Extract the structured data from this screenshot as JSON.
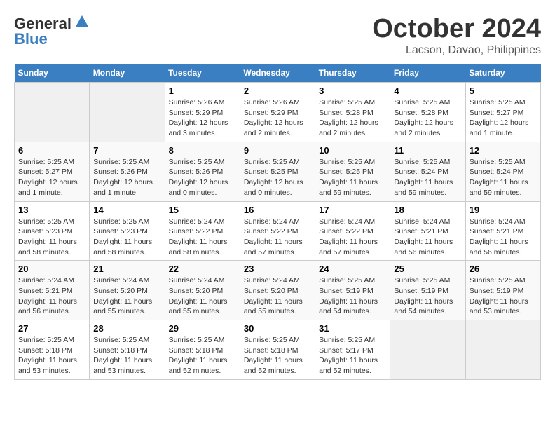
{
  "header": {
    "logo_general": "General",
    "logo_blue": "Blue",
    "month_title": "October 2024",
    "location": "Lacson, Davao, Philippines"
  },
  "calendar": {
    "days_of_week": [
      "Sunday",
      "Monday",
      "Tuesday",
      "Wednesday",
      "Thursday",
      "Friday",
      "Saturday"
    ],
    "weeks": [
      [
        {
          "day": "",
          "info": ""
        },
        {
          "day": "",
          "info": ""
        },
        {
          "day": "1",
          "info": "Sunrise: 5:26 AM\nSunset: 5:29 PM\nDaylight: 12 hours and 3 minutes."
        },
        {
          "day": "2",
          "info": "Sunrise: 5:26 AM\nSunset: 5:29 PM\nDaylight: 12 hours and 2 minutes."
        },
        {
          "day": "3",
          "info": "Sunrise: 5:25 AM\nSunset: 5:28 PM\nDaylight: 12 hours and 2 minutes."
        },
        {
          "day": "4",
          "info": "Sunrise: 5:25 AM\nSunset: 5:28 PM\nDaylight: 12 hours and 2 minutes."
        },
        {
          "day": "5",
          "info": "Sunrise: 5:25 AM\nSunset: 5:27 PM\nDaylight: 12 hours and 1 minute."
        }
      ],
      [
        {
          "day": "6",
          "info": "Sunrise: 5:25 AM\nSunset: 5:27 PM\nDaylight: 12 hours and 1 minute."
        },
        {
          "day": "7",
          "info": "Sunrise: 5:25 AM\nSunset: 5:26 PM\nDaylight: 12 hours and 1 minute."
        },
        {
          "day": "8",
          "info": "Sunrise: 5:25 AM\nSunset: 5:26 PM\nDaylight: 12 hours and 0 minutes."
        },
        {
          "day": "9",
          "info": "Sunrise: 5:25 AM\nSunset: 5:25 PM\nDaylight: 12 hours and 0 minutes."
        },
        {
          "day": "10",
          "info": "Sunrise: 5:25 AM\nSunset: 5:25 PM\nDaylight: 11 hours and 59 minutes."
        },
        {
          "day": "11",
          "info": "Sunrise: 5:25 AM\nSunset: 5:24 PM\nDaylight: 11 hours and 59 minutes."
        },
        {
          "day": "12",
          "info": "Sunrise: 5:25 AM\nSunset: 5:24 PM\nDaylight: 11 hours and 59 minutes."
        }
      ],
      [
        {
          "day": "13",
          "info": "Sunrise: 5:25 AM\nSunset: 5:23 PM\nDaylight: 11 hours and 58 minutes."
        },
        {
          "day": "14",
          "info": "Sunrise: 5:25 AM\nSunset: 5:23 PM\nDaylight: 11 hours and 58 minutes."
        },
        {
          "day": "15",
          "info": "Sunrise: 5:24 AM\nSunset: 5:22 PM\nDaylight: 11 hours and 58 minutes."
        },
        {
          "day": "16",
          "info": "Sunrise: 5:24 AM\nSunset: 5:22 PM\nDaylight: 11 hours and 57 minutes."
        },
        {
          "day": "17",
          "info": "Sunrise: 5:24 AM\nSunset: 5:22 PM\nDaylight: 11 hours and 57 minutes."
        },
        {
          "day": "18",
          "info": "Sunrise: 5:24 AM\nSunset: 5:21 PM\nDaylight: 11 hours and 56 minutes."
        },
        {
          "day": "19",
          "info": "Sunrise: 5:24 AM\nSunset: 5:21 PM\nDaylight: 11 hours and 56 minutes."
        }
      ],
      [
        {
          "day": "20",
          "info": "Sunrise: 5:24 AM\nSunset: 5:21 PM\nDaylight: 11 hours and 56 minutes."
        },
        {
          "day": "21",
          "info": "Sunrise: 5:24 AM\nSunset: 5:20 PM\nDaylight: 11 hours and 55 minutes."
        },
        {
          "day": "22",
          "info": "Sunrise: 5:24 AM\nSunset: 5:20 PM\nDaylight: 11 hours and 55 minutes."
        },
        {
          "day": "23",
          "info": "Sunrise: 5:24 AM\nSunset: 5:20 PM\nDaylight: 11 hours and 55 minutes."
        },
        {
          "day": "24",
          "info": "Sunrise: 5:25 AM\nSunset: 5:19 PM\nDaylight: 11 hours and 54 minutes."
        },
        {
          "day": "25",
          "info": "Sunrise: 5:25 AM\nSunset: 5:19 PM\nDaylight: 11 hours and 54 minutes."
        },
        {
          "day": "26",
          "info": "Sunrise: 5:25 AM\nSunset: 5:19 PM\nDaylight: 11 hours and 53 minutes."
        }
      ],
      [
        {
          "day": "27",
          "info": "Sunrise: 5:25 AM\nSunset: 5:18 PM\nDaylight: 11 hours and 53 minutes."
        },
        {
          "day": "28",
          "info": "Sunrise: 5:25 AM\nSunset: 5:18 PM\nDaylight: 11 hours and 53 minutes."
        },
        {
          "day": "29",
          "info": "Sunrise: 5:25 AM\nSunset: 5:18 PM\nDaylight: 11 hours and 52 minutes."
        },
        {
          "day": "30",
          "info": "Sunrise: 5:25 AM\nSunset: 5:18 PM\nDaylight: 11 hours and 52 minutes."
        },
        {
          "day": "31",
          "info": "Sunrise: 5:25 AM\nSunset: 5:17 PM\nDaylight: 11 hours and 52 minutes."
        },
        {
          "day": "",
          "info": ""
        },
        {
          "day": "",
          "info": ""
        }
      ]
    ]
  }
}
